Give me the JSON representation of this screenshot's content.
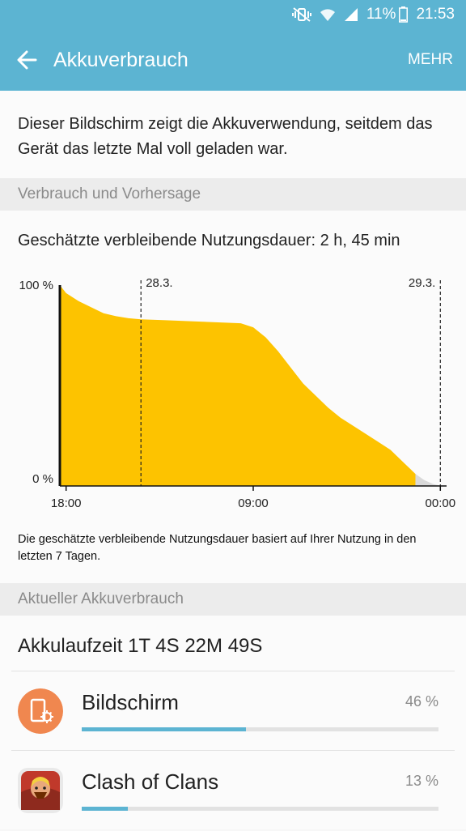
{
  "status_bar": {
    "battery_percent": "11%",
    "time": "21:53",
    "icons": [
      "mute-vibrate-icon",
      "wifi-icon",
      "signal-icon",
      "battery-icon"
    ]
  },
  "app_bar": {
    "back_icon": "arrow-left-icon",
    "title": "Akkuverbrauch",
    "more_label": "MEHR"
  },
  "intro_text": "Dieser Bildschirm zeigt die Akkuverwendung, seitdem das Gerät das letzte Mal voll geladen war.",
  "sections": {
    "usage_forecast": "Verbrauch und Vorhersage",
    "current_usage": "Aktueller Akkuverbrauch"
  },
  "estimate_text": "Geschätzte verbleibende Nutzungsdauer: 2 h, 45 min",
  "footnote": "Die geschätzte verbleibende Nutzungsdauer basiert auf Ihrer Nutzung in den letzten 7 Tagen.",
  "chart_data": {
    "type": "area",
    "y_tick_labels": [
      "100 %",
      "0 %"
    ],
    "x_tick_labels": [
      "18:00",
      "09:00",
      "00:00"
    ],
    "day_markers": [
      "28.3.",
      "29.3."
    ],
    "ylim": [
      0,
      100
    ],
    "x_hours_range": [
      -0.5,
      30.5
    ],
    "x_ticks_hours": [
      0,
      15,
      30
    ],
    "day_marker_hours": [
      6,
      30
    ],
    "series": [
      {
        "values_type": "actual",
        "color": "#fdc300",
        "points": [
          [
            -0.5,
            100
          ],
          [
            0,
            96
          ],
          [
            1,
            92
          ],
          [
            2,
            89
          ],
          [
            3,
            86
          ],
          [
            4,
            84.5
          ],
          [
            5,
            83.5
          ],
          [
            6,
            83
          ],
          [
            8,
            82.5
          ],
          [
            10,
            82
          ],
          [
            12,
            81.5
          ],
          [
            14,
            81
          ],
          [
            15,
            79
          ],
          [
            16,
            74
          ],
          [
            17,
            67
          ],
          [
            18,
            59
          ],
          [
            19,
            51
          ],
          [
            20,
            45
          ],
          [
            21,
            39
          ],
          [
            22,
            34
          ],
          [
            23,
            30
          ],
          [
            24,
            26
          ],
          [
            25,
            22
          ],
          [
            26,
            18
          ],
          [
            27,
            12
          ],
          [
            28,
            6
          ]
        ]
      },
      {
        "values_type": "predicted",
        "color": "#d9d9d9",
        "points": [
          [
            28,
            6
          ],
          [
            28.7,
            3
          ],
          [
            29.4,
            1
          ],
          [
            30.1,
            0
          ]
        ]
      }
    ],
    "grid": false,
    "legend": "none"
  },
  "uptime": "Akkulaufzeit 1T 4S 22M 49S",
  "usage_items": [
    {
      "name": "Bildschirm",
      "percent_label": "46 %",
      "percent": 46,
      "icon": "screen-settings-icon",
      "icon_color": "#f0874f"
    },
    {
      "name": "Clash of Clans",
      "percent_label": "13 %",
      "percent": 13,
      "icon": "clash-of-clans-app-icon",
      "icon_color": "#c0392b"
    }
  ],
  "colors": {
    "accent": "#5cb4d2",
    "chart_fill": "#fdc300",
    "prediction_fill": "#d9d9d9"
  }
}
